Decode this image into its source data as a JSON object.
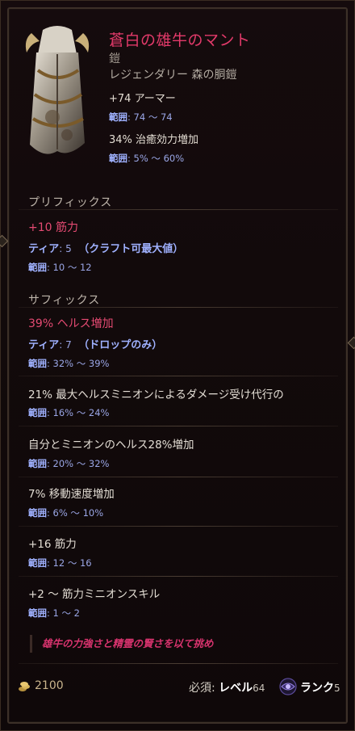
{
  "item": {
    "name": "蒼白の雄牛のマント",
    "type": "鎧",
    "subtype": "レジェンダリー 森の胴鎧"
  },
  "base_stats": [
    {
      "text": "+74 アーマー",
      "range_label": "範囲",
      "range_value": ": 74 〜 74"
    },
    {
      "text": "34% 治癒効力増加",
      "range_label": "範囲",
      "range_value": ": 5% 〜 60%"
    }
  ],
  "prefix": {
    "title": "プリフィックス",
    "name": "+10 筋力",
    "tier_label": "ティア",
    "tier_value": ": 5",
    "tier_note": "（クラフト可最大値）",
    "range_label": "範囲",
    "range_value": ": 10 〜 12"
  },
  "suffix": {
    "title": "サフィックス",
    "name": "39% ヘルス増加",
    "tier_label": "ティア",
    "tier_value": ": 7",
    "tier_note": "（ドロップのみ）",
    "range_label": "範囲",
    "range_value": ": 32% 〜 39%"
  },
  "implicits": [
    {
      "text": "21% 最大ヘルスミニオンによるダメージ受け代行の",
      "range_label": "範囲",
      "range_value": ": 16% 〜 24%"
    },
    {
      "text": "自分とミニオンのヘルス28%増加",
      "range_label": "範囲",
      "range_value": ": 20% 〜 32%"
    },
    {
      "text": "7% 移動速度増加",
      "range_label": "範囲",
      "range_value": ": 6% 〜 10%"
    },
    {
      "text": "+16 筋力",
      "range_label": "範囲",
      "range_value": ": 12 〜 16"
    },
    {
      "text": "+2 〜 筋力ミニオンスキル",
      "range_label": "範囲",
      "range_value": ": 1 〜 2"
    }
  ],
  "flavor": "雄牛の力強さと精霊の賢さを以て挑め",
  "footer": {
    "gold": "2100",
    "required_label": "必須:",
    "level_label": "レベル",
    "level_value": "64",
    "rank_label": "ランク",
    "rank_value": "5"
  },
  "colors": {
    "legendary": "#e23a6a",
    "range": "#9aa6e6",
    "flavor": "#d8336e"
  },
  "icons": [
    "item-art-cloak-icon",
    "gold-coin-icon",
    "rank-eye-icon"
  ]
}
